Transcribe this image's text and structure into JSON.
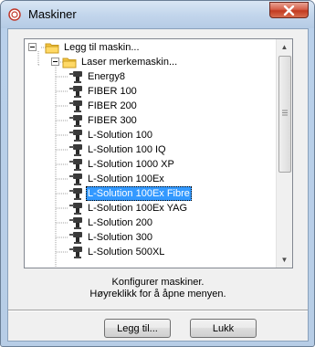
{
  "window": {
    "title": "Maskiner",
    "close_glyph": "✕"
  },
  "tree": {
    "root": {
      "label": "Legg til maskin...",
      "icon": "folder-icon",
      "expanded": true
    },
    "group": {
      "label": "Laser merkemaskin...",
      "icon": "folder-icon",
      "expanded": true
    },
    "machines": [
      {
        "label": "Energy8"
      },
      {
        "label": "FIBER 100"
      },
      {
        "label": "FIBER 200"
      },
      {
        "label": "FIBER 300"
      },
      {
        "label": "L-Solution 100"
      },
      {
        "label": "L-Solution 100 IQ"
      },
      {
        "label": "L-Solution 1000 XP"
      },
      {
        "label": "L-Solution 100Ex"
      },
      {
        "label": "L-Solution 100Ex Fibre",
        "selected": true
      },
      {
        "label": "L-Solution 100Ex YAG"
      },
      {
        "label": "L-Solution 200"
      },
      {
        "label": "L-Solution 300"
      },
      {
        "label": "L-Solution 500XL"
      }
    ],
    "selection_color": "#3399ff"
  },
  "info": {
    "line1": "Konfigurer maskiner.",
    "line2": "Høyreklikk for å åpne menyen."
  },
  "buttons": {
    "add_label": "Legg til...",
    "close_label": "Lukk"
  }
}
